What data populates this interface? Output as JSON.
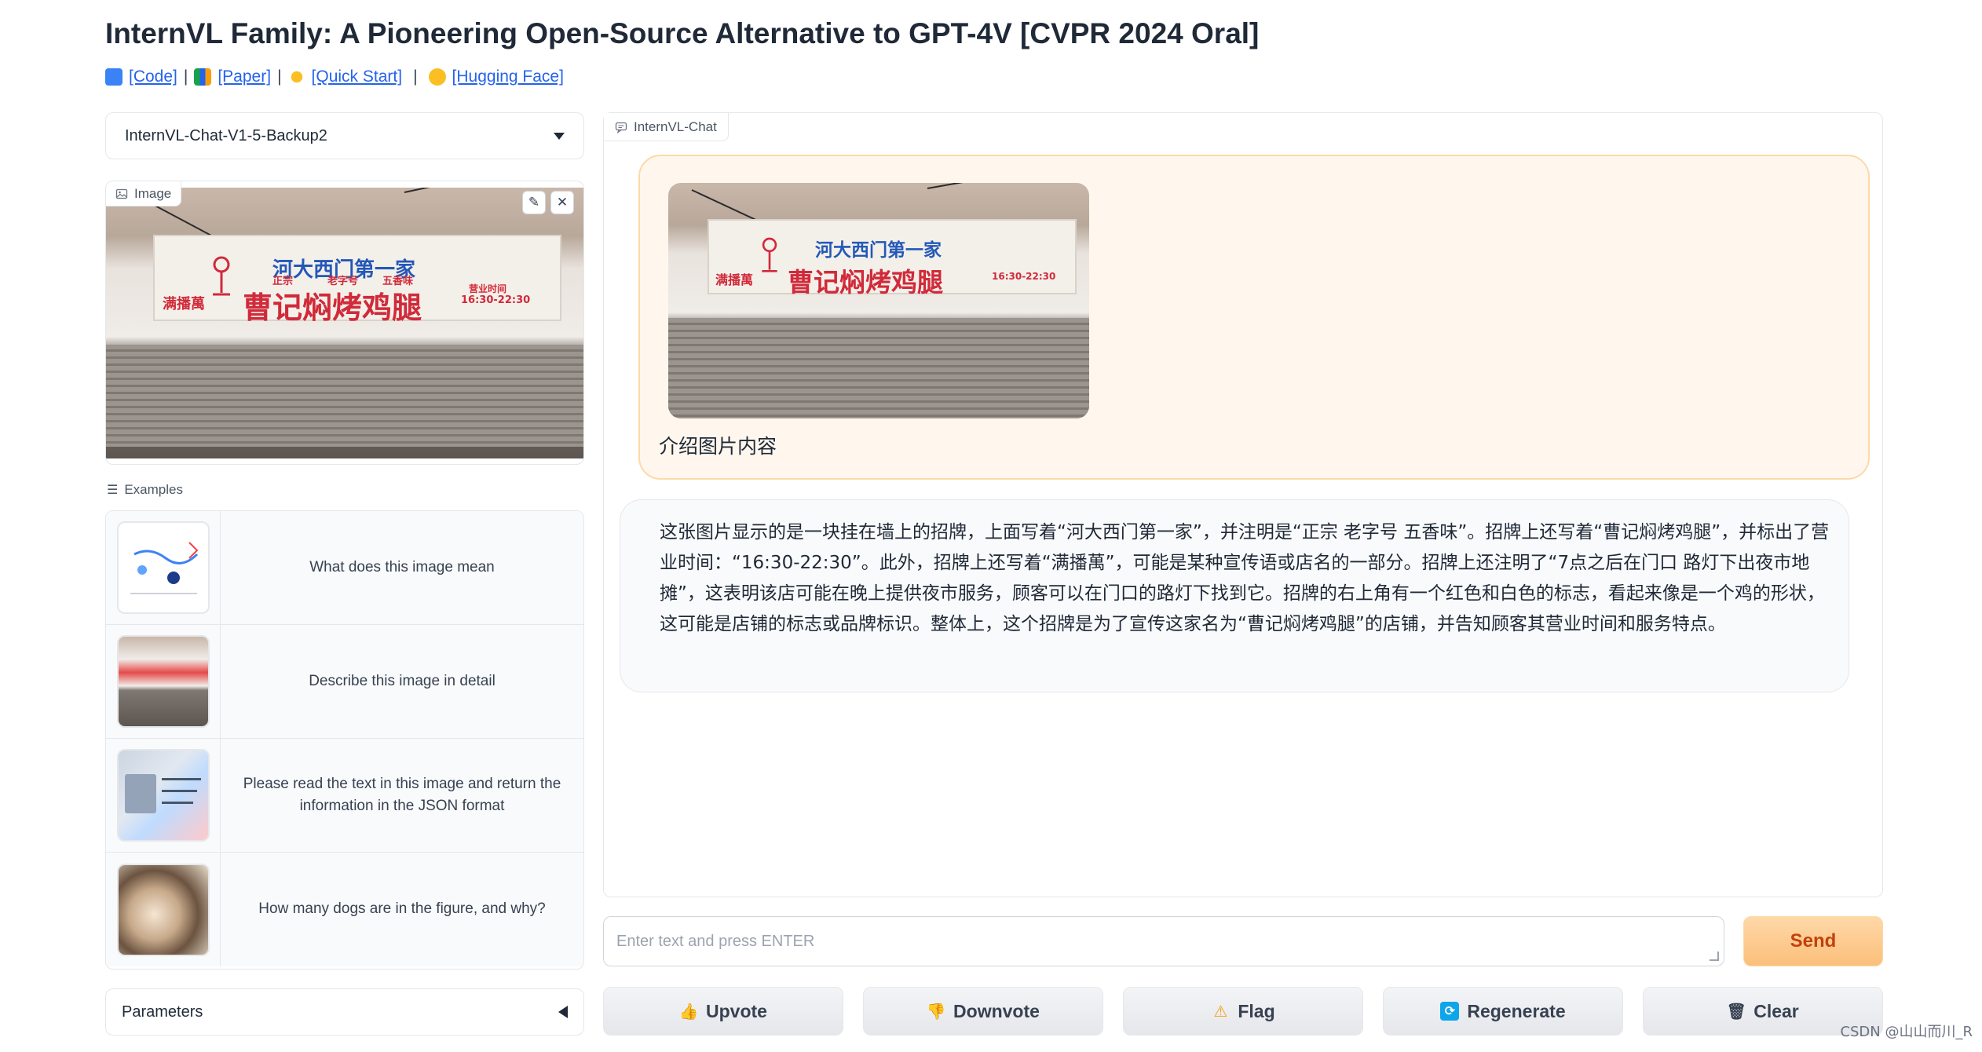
{
  "header": {
    "title": "InternVL Family: A Pioneering Open-Source Alternative to GPT-4V [CVPR 2024 Oral]",
    "links": [
      {
        "label": "[Code]",
        "icon": "laptop-icon"
      },
      {
        "label": "[Paper]",
        "icon": "books-icon"
      },
      {
        "label": "[Quick Start]",
        "icon": "sun-icon"
      },
      {
        "label": "[Hugging Face]",
        "icon": "hugging-face-icon"
      }
    ]
  },
  "model_select": {
    "value": "InternVL-Chat-V1-5-Backup2"
  },
  "image_panel": {
    "label": "Image",
    "sign": {
      "top_line": "河大西门第一家",
      "main_text": "曹记焖烤鸡腿",
      "left_text": "满播萬",
      "small_left": "正宗",
      "small_mid": "老字号",
      "small_right": "五香味",
      "hours_label": "营业时间",
      "hours": "16:30-22:30"
    }
  },
  "examples": {
    "label": "Examples",
    "items": [
      {
        "text": "What does this image mean"
      },
      {
        "text": "Describe this image in detail"
      },
      {
        "text": "Please read the text in this image and return the information in the JSON format"
      },
      {
        "text": "How many dogs are in the figure, and why?"
      }
    ]
  },
  "parameters": {
    "label": "Parameters"
  },
  "chat": {
    "label": "InternVL-Chat",
    "user_message": "介绍图片内容",
    "bot_message": "这张图片显示的是一块挂在墙上的招牌，上面写着“河大西门第一家”，并注明是“正宗 老字号 五香味”。招牌上还写着“曹记焖烤鸡腿”，并标出了营业时间：“16:30-22:30”。此外，招牌上还写着“满播萬”，可能是某种宣传语或店名的一部分。招牌上还注明了“7点之后在门口 路灯下出夜市地摊”，这表明该店可能在晚上提供夜市服务，顾客可以在门口的路灯下找到它。招牌的右上角有一个红色和白色的标志，看起来像是一个鸡的形状，这可能是店铺的标志或品牌标识。整体上，这个招牌是为了宣传这家名为“曹记焖烤鸡腿”的店铺，并告知顾客其营业时间和服务特点。"
  },
  "input": {
    "placeholder": "Enter text and press ENTER"
  },
  "buttons": {
    "send": "Send",
    "upvote": "Upvote",
    "downvote": "Downvote",
    "flag": "Flag",
    "regenerate": "Regenerate",
    "clear": "Clear"
  },
  "watermark": "CSDN @山山而川_R",
  "colors": {
    "accent": "#fbbf7a",
    "link": "#2563eb",
    "user_bubble": "#fff7ed"
  }
}
